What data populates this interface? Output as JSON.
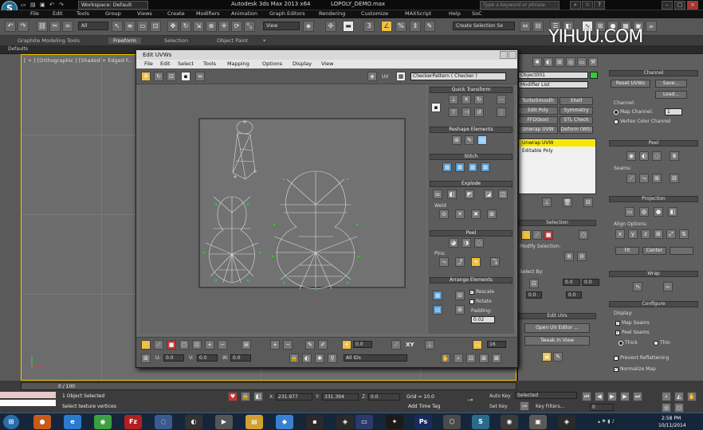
{
  "app": {
    "workspace": "Workspace: Default",
    "title": "Autodesk 3ds Max  2013 x64",
    "file": "LOPOLY_DEMO.max",
    "search_placeholder": "Type a keyword or phrase",
    "watermark": "YIHUU.COM"
  },
  "menu": [
    "File",
    "Edit",
    "Tools",
    "Group",
    "Views",
    "Create",
    "Modifiers",
    "Animation",
    "Graph Editors",
    "Rendering",
    "Customize",
    "MAXScript",
    "Help",
    "SoC"
  ],
  "toolbar": {
    "selection_filter": "All",
    "coord_system": "View",
    "named_selection": "Create Selection Se"
  },
  "ribbon": {
    "tabs": [
      "Graphite Modeling Tools",
      "Freeform",
      "Selection",
      "Object Paint"
    ],
    "defaults": "Defaults"
  },
  "viewport": {
    "label": "[ + ] [Orthographic ] [Shaded + Edged F..."
  },
  "uvw": {
    "title": "Edit UVWs",
    "menu": [
      "File",
      "Edit",
      "Select",
      "Tools",
      "Mapping",
      "Options",
      "Display",
      "View"
    ],
    "uv_label": "UV",
    "checker": "CheckerPattern  ( Checker )",
    "sections": {
      "quick_transform": "Quick Transform",
      "reshape": "Reshape Elements",
      "stitch": "Stitch",
      "explode": "Explode",
      "weld": "Weld",
      "peel": "Peel",
      "pins": "Pins:",
      "arrange": "Arrange Elements",
      "rescale": "Rescale",
      "rotate": "Rotate",
      "padding": "Padding:",
      "padding_value": "0.02"
    },
    "bottom": {
      "u": "U:",
      "u_val": "0.0",
      "v": "V:",
      "v_val": "0.0",
      "w": "W:",
      "w_val": "0.0",
      "ids": "All IDs",
      "xy": "XY",
      "spin1": "0.0",
      "spin2": "16"
    }
  },
  "cmdpanel": {
    "object_name": "Object001",
    "modifier_list": "Modifier List",
    "buttons": [
      "TurboSmooth",
      "Shell",
      "Edit Poly",
      "Symmetry",
      "FFD(box)",
      "STL Check",
      "Unwrap UVW",
      "Deform (WS)"
    ],
    "stack": [
      "Unwrap UVW",
      "Editable Poly"
    ],
    "selection_title": "Selection",
    "modify_selection": "Modify Selection:",
    "select_by": "Select By:",
    "spin_a": "0.0",
    "spin_b": "0.0",
    "spin_c": "0.0",
    "spin_d": "0.0",
    "edit_uvs_title": "Edit UVs",
    "open_uv_editor": "Open UV Editor ...",
    "tweak_in_view": "Tweak In View"
  },
  "rollout": {
    "channel_title": "Channel",
    "reset_uvws": "Reset UVWs",
    "save": "Save...",
    "load": "Load...",
    "channel_label": "Channel:",
    "map_channel": "Map Channel:",
    "map_channel_val": "1",
    "vertex_color": "Vertex Color Channel",
    "peel_title": "Peel",
    "seams": "Seams:",
    "projection_title": "Projection",
    "align_options": "Align Options:",
    "fit": "Fit",
    "center": "Center",
    "wrap_title": "Wrap",
    "configure_title": "Configure",
    "display": "Display:",
    "map_seams": "Map Seams",
    "peel_seams": "Peel Seams",
    "thick": "Thick",
    "thin": "Thin",
    "prevent_reflattening": "Prevent Reflattening",
    "normalize_map": "Normalize Map"
  },
  "status": {
    "timeline": "0 / 100",
    "objects_selected": "1 Object Selected",
    "prompt": "Select texture vertices",
    "x": "X:",
    "x_val": "231.977",
    "y": "Y:",
    "y_val": "331.394",
    "z": "Z:",
    "z_val": "0.0",
    "grid": "Grid = 10.0",
    "add_time_tag": "Add Time Tag",
    "auto_key": "Auto Key",
    "set_key": "Set Key",
    "selected": "Selected",
    "key_filters": "Key Filters...",
    "frame": "0"
  },
  "taskbar": {
    "time": "2:58 PM",
    "date": "10/11/2014"
  }
}
